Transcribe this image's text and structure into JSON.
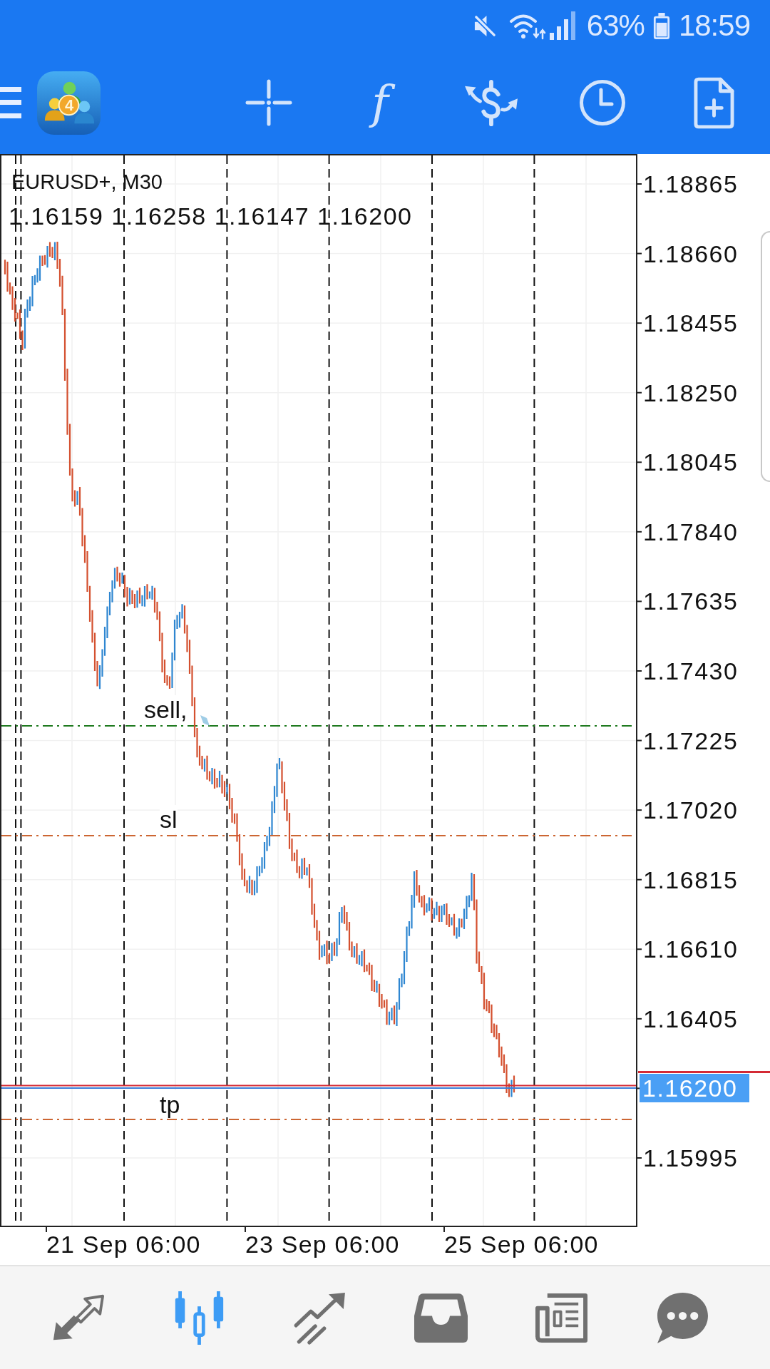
{
  "status_bar": {
    "battery": "63%",
    "time": "18:59"
  },
  "toolbar": {
    "logo_badge": "4",
    "function_label": "f"
  },
  "chart": {
    "symbol": "EURUSD+, M30",
    "ohlc": "1.16159 1.16258 1.16147 1.16200",
    "levels": [
      {
        "label": "sell,",
        "color": "#1f7a1f"
      },
      {
        "label": "sl",
        "color": "#cc6633"
      },
      {
        "label": "tp",
        "color": "#cc6633"
      }
    ],
    "price_axis": [
      {
        "label": "1.18865",
        "kind": "tick"
      },
      {
        "label": "1.18660",
        "kind": "tick"
      },
      {
        "label": "1.18455",
        "kind": "tick"
      },
      {
        "label": "1.18250",
        "kind": "tick"
      },
      {
        "label": "1.18045",
        "kind": "tick"
      },
      {
        "label": "1.17840",
        "kind": "tick"
      },
      {
        "label": "1.17635",
        "kind": "tick"
      },
      {
        "label": "1.17430",
        "kind": "tick"
      },
      {
        "label": "1.17225",
        "kind": "tick"
      },
      {
        "label": "1.17020",
        "kind": "tick"
      },
      {
        "label": "1.16815",
        "kind": "tick"
      },
      {
        "label": "1.16610",
        "kind": "tick"
      },
      {
        "label": "1.16405",
        "kind": "tick"
      },
      {
        "label": "1.16200",
        "kind": "current"
      },
      {
        "label": "1.15995",
        "kind": "tick"
      }
    ],
    "time_axis": [
      "21 Sep 06:00",
      "23 Sep 06:00",
      "25 Sep 06:00"
    ]
  },
  "bottom_nav": [
    {
      "kind": "arrows",
      "selected": false
    },
    {
      "kind": "candles",
      "selected": true
    },
    {
      "kind": "trend",
      "selected": false
    },
    {
      "kind": "tray",
      "selected": false
    },
    {
      "kind": "newspaper",
      "selected": false
    },
    {
      "kind": "chat",
      "selected": false
    }
  ]
}
